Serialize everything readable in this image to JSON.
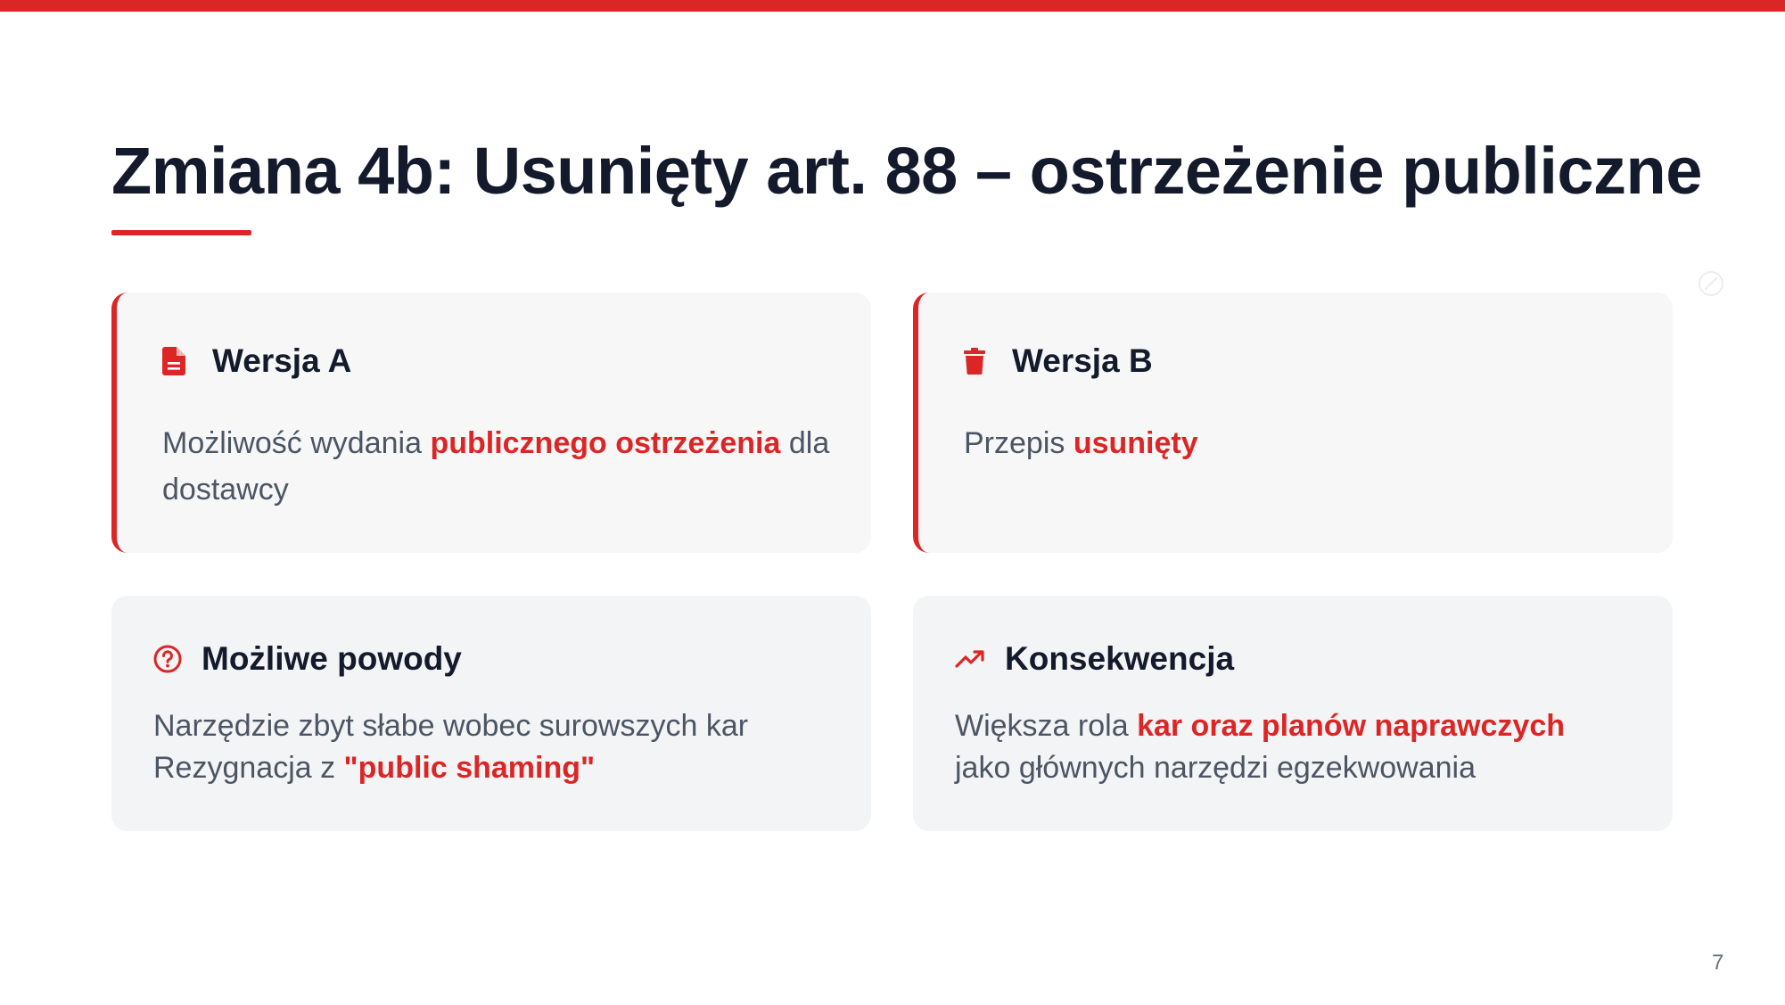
{
  "colors": {
    "accent": "#dc2626",
    "heading": "#131a2b",
    "body_text": "#4b5563",
    "card_bg": "#f7f7f8",
    "card_bg_soft": "#f3f4f6"
  },
  "slide": {
    "title": "Zmiana 4b: Usunięty art. 88 – ostrzeżenie publiczne",
    "page_number": "7"
  },
  "cards": [
    {
      "icon": "file-document-icon",
      "heading": "Wersja A",
      "body": [
        {
          "text": "Możliwość wydania ",
          "highlight": false
        },
        {
          "text": "publicznego ostrzeżenia",
          "highlight": true
        },
        {
          "text": " dla dostawcy",
          "highlight": false
        }
      ]
    },
    {
      "icon": "trash-icon",
      "heading": "Wersja B",
      "body": [
        {
          "text": "Przepis ",
          "highlight": false
        },
        {
          "text": "usunięty",
          "highlight": true
        }
      ]
    },
    {
      "icon": "question-circle-icon",
      "heading": "Możliwe powody",
      "lines": [
        [
          {
            "text": "Narzędzie zbyt słabe wobec surowszych kar",
            "highlight": false
          }
        ],
        [
          {
            "text": "Rezygnacja z ",
            "highlight": false
          },
          {
            "text": "\"public shaming\"",
            "highlight": true
          }
        ]
      ]
    },
    {
      "icon": "trending-up-icon",
      "heading": "Konsekwencja",
      "body": [
        {
          "text": "Większa rola ",
          "highlight": false
        },
        {
          "text": "kar oraz planów naprawczych",
          "highlight": true
        },
        {
          "text": " jako głównych narzędzi egzekwowania",
          "highlight": false
        }
      ]
    }
  ]
}
